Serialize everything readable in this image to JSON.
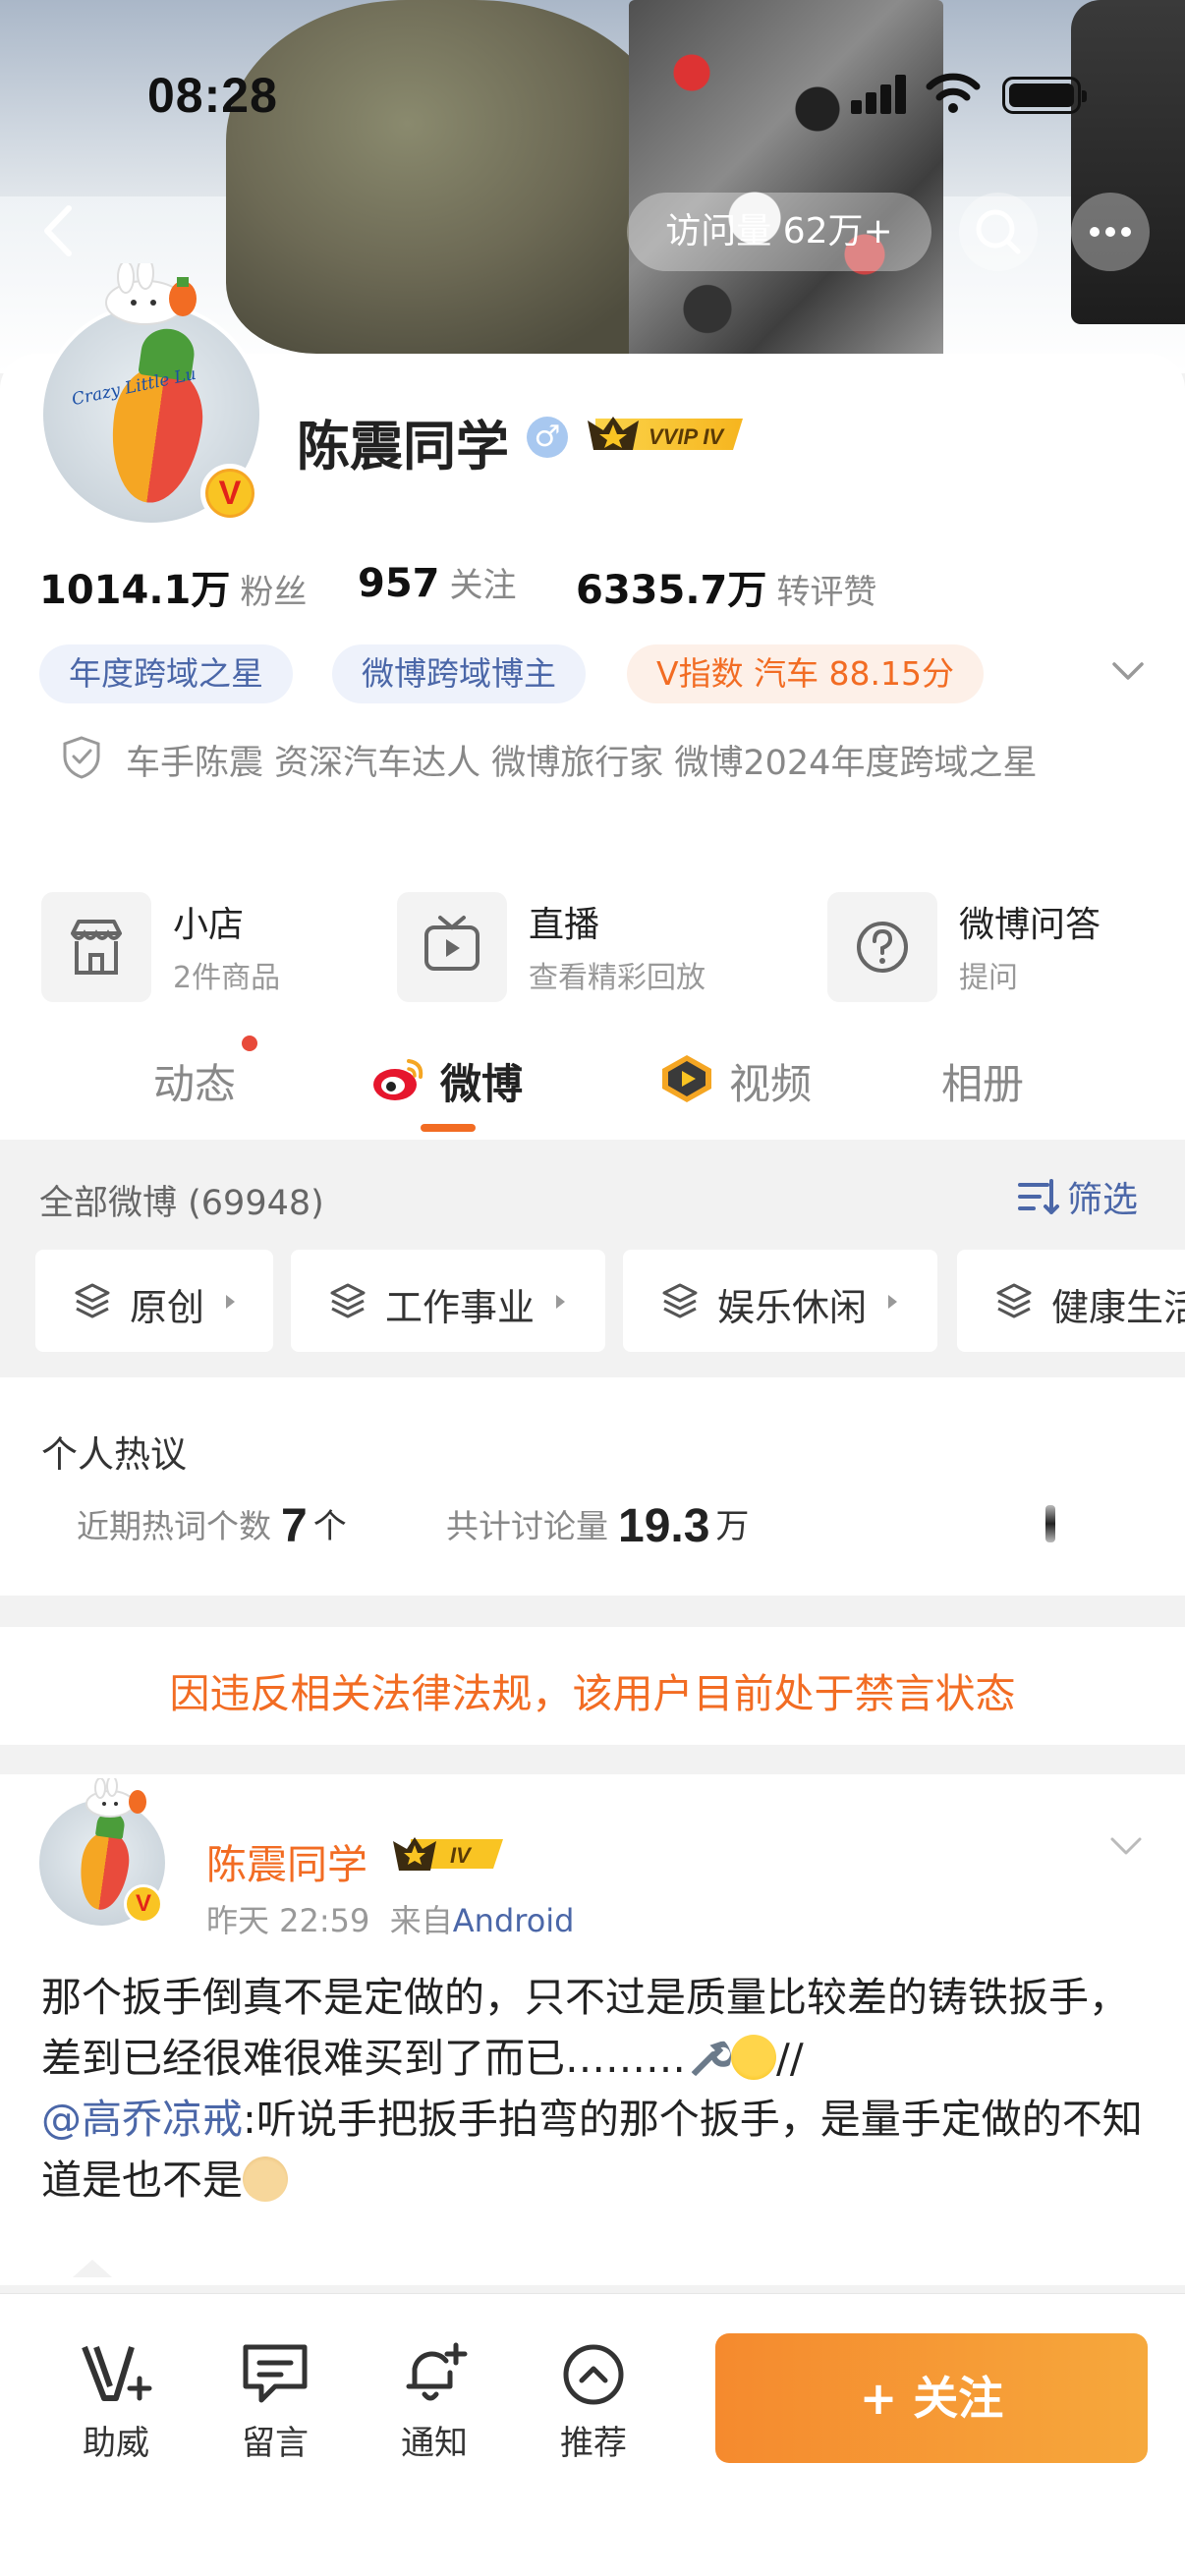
{
  "status_bar": {
    "time": "08:28"
  },
  "nav": {
    "visits": "访问量 62万+"
  },
  "profile": {
    "name": "陈震同学",
    "vip_badge": "VVIP IV",
    "avatar_text": "Crazy Little Lu",
    "stats": [
      {
        "value": "1014.1万",
        "label": "粉丝"
      },
      {
        "value": "957",
        "label": "关注"
      },
      {
        "value": "6335.7万",
        "label": "转评赞"
      }
    ],
    "tags": [
      "年度跨域之星",
      "微博跨域博主",
      "V指数 汽车 88.15分"
    ],
    "bio": "车手陈震 资深汽车达人  微博旅行家 微博2024年度跨域之星",
    "shortcuts": [
      {
        "title": "小店",
        "sub": "2件商品",
        "icon": "store-icon"
      },
      {
        "title": "直播",
        "sub": "查看精彩回放",
        "icon": "tv-icon"
      },
      {
        "title": "微博问答",
        "sub": "提问",
        "icon": "question-icon"
      }
    ],
    "tabs": [
      "动态",
      "微博",
      "视频",
      "相册"
    ]
  },
  "filter": {
    "all_count": "全部微博 (69948)",
    "filter_label": "筛选",
    "chips": [
      "原创",
      "工作事业",
      "娱乐休闲",
      "健康生活"
    ]
  },
  "hot": {
    "title": "个人热议",
    "recent_label": "近期热词个数",
    "recent_value": "7",
    "recent_unit": "个",
    "total_label": "共计讨论量",
    "total_value": "19.3",
    "total_unit": "万"
  },
  "ban_notice": "因违反相关法律法规，该用户目前处于禁言状态",
  "post": {
    "author": "陈震同学",
    "level": "IV",
    "time": "昨天 22:59",
    "source_prefix": "来自",
    "source": "Android",
    "text_1": "那个扳手倒真不是定做的，只不过是质量比较差的铸铁扳手，差到已经很难很难买到了而已………",
    "text_2": "//",
    "mention": "@高乔凉戒",
    "text_3": ":听说手把扳手拍弯的那个扳手，是量手定做的不知道是也不是"
  },
  "bottom_bar": {
    "items": [
      "助威",
      "留言",
      "通知",
      "推荐"
    ],
    "follow": "+ 关注"
  },
  "colors": {
    "accent": "#f26c23",
    "link": "#4b67a8"
  }
}
